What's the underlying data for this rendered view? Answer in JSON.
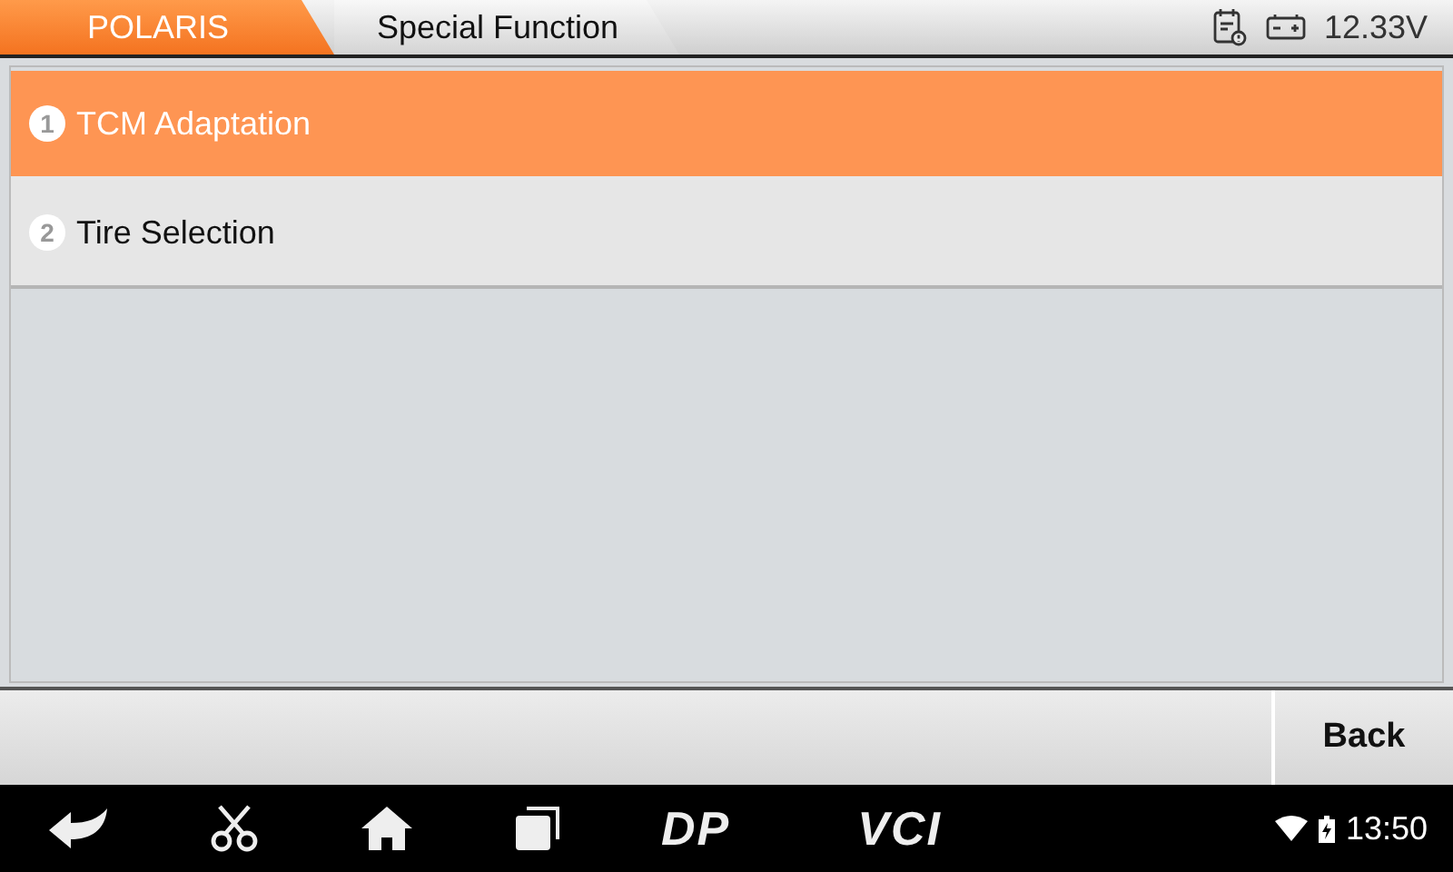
{
  "breadcrumbs": [
    {
      "label": "POLARIS",
      "selected": true
    },
    {
      "label": "Special Function",
      "selected": false
    }
  ],
  "status": {
    "voltage": "12.33V"
  },
  "menu": [
    {
      "number": "1",
      "label": "TCM Adaptation",
      "selected": true
    },
    {
      "number": "2",
      "label": "Tire Selection",
      "selected": false
    }
  ],
  "buttons": [
    "Back"
  ],
  "nav_bar": {
    "logos": [
      "DP",
      "VCI"
    ],
    "time": "13:50"
  }
}
